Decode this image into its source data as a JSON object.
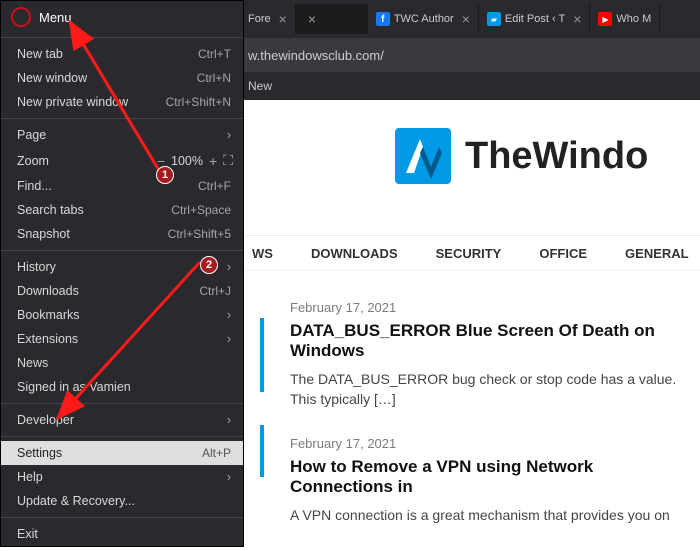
{
  "menu": {
    "header": "Menu",
    "items_a": [
      {
        "label": "New tab",
        "shortcut": "Ctrl+T"
      },
      {
        "label": "New window",
        "shortcut": "Ctrl+N"
      },
      {
        "label": "New private window",
        "shortcut": "Ctrl+Shift+N"
      }
    ],
    "page_label": "Page",
    "zoom_label": "Zoom",
    "zoom_value": "100%",
    "find_label": "Find...",
    "find_shortcut": "Ctrl+F",
    "search_tabs_label": "Search tabs",
    "search_tabs_shortcut": "Ctrl+Space",
    "snapshot_label": "Snapshot",
    "snapshot_shortcut": "Ctrl+Shift+5",
    "items_c": [
      {
        "label": "History"
      },
      {
        "label": "Downloads",
        "shortcut": "Ctrl+J"
      },
      {
        "label": "Bookmarks"
      },
      {
        "label": "Extensions"
      }
    ],
    "news_label": "News",
    "signed_in_label": "Signed in as Vamien",
    "developer_label": "Developer",
    "settings_label": "Settings",
    "settings_shortcut": "Alt+P",
    "help_label": "Help",
    "update_label": "Update & Recovery...",
    "exit_label": "Exit"
  },
  "tabs": {
    "t0": "Fore",
    "t1": "TWC Author",
    "t2": "Edit Post ‹ T",
    "t3": "Who M"
  },
  "address": "w.thewindowsclub.com/",
  "bookmarks": {
    "new": "New"
  },
  "site": {
    "logo_text": "TheWindo",
    "nav": {
      "n0": "WS",
      "n1": "DOWNLOADS",
      "n2": "SECURITY",
      "n3": "OFFICE",
      "n4": "GENERAL"
    }
  },
  "posts": [
    {
      "date": "February 17, 2021",
      "title": "DATA_BUS_ERROR Blue Screen Of Death on Windows",
      "excerpt": "The DATA_BUS_ERROR bug check or stop code has a value. This typically […]"
    },
    {
      "date": "February 17, 2021",
      "title": "How to Remove a VPN using Network Connections in",
      "excerpt": "A VPN connection is a great mechanism that provides you on"
    }
  ],
  "annotations": {
    "a1": "1",
    "a2": "2"
  }
}
